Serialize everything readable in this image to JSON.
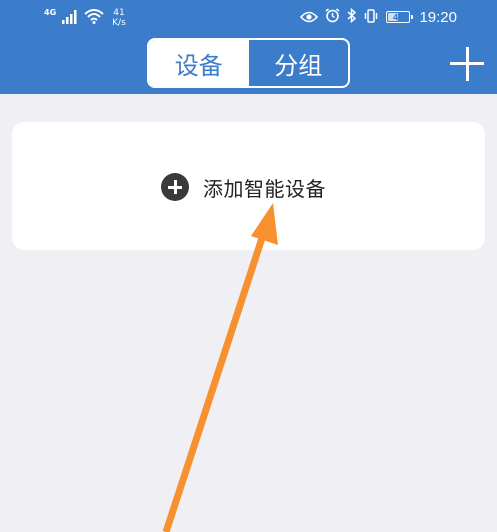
{
  "status_bar": {
    "network_type": "4G",
    "net_speed_value": "41",
    "net_speed_unit": "K/s",
    "battery_level": "43",
    "time": "19:20",
    "icons": [
      "signal-icon",
      "wifi-icon",
      "eye-icon",
      "alarm-icon",
      "bluetooth-icon",
      "vibrate-icon",
      "battery-icon"
    ]
  },
  "header": {
    "tabs": [
      {
        "label": "设备",
        "active": true
      },
      {
        "label": "分组",
        "active": false
      }
    ],
    "add_icon": "plus-icon"
  },
  "card": {
    "add_device_label": "添加智能设备",
    "add_icon": "plus-circle-icon"
  },
  "annotation": {
    "type": "arrow",
    "color": "#f7902e"
  },
  "colors": {
    "header_blue": "#3b7dcb",
    "background": "#efeff4",
    "card": "#ffffff",
    "arrow_orange": "#f7902e"
  }
}
